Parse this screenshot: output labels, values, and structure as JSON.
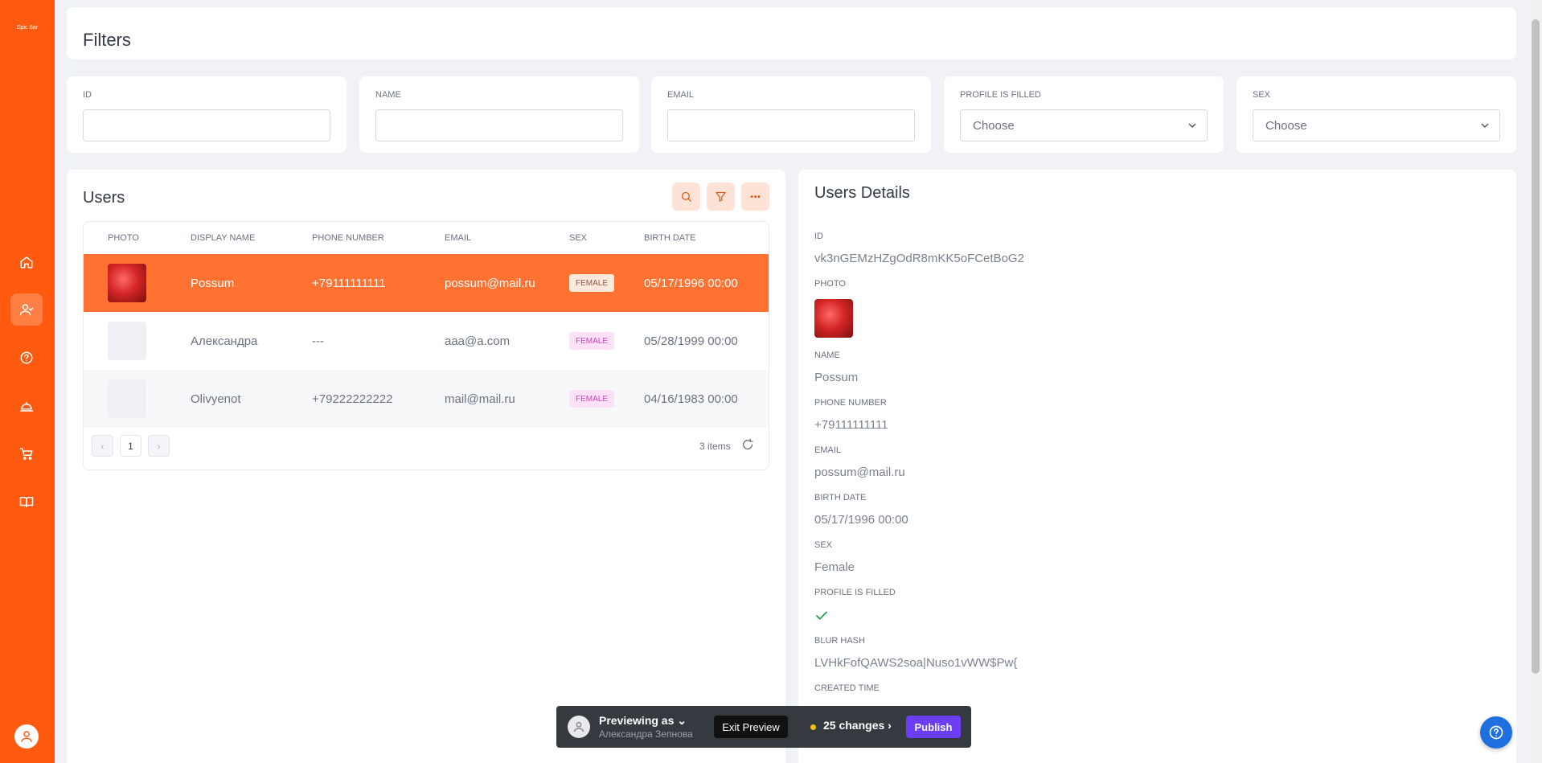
{
  "sidebar": {
    "brand": "Epic Bar",
    "items": [
      {
        "name": "home-icon"
      },
      {
        "name": "users-icon",
        "active": true
      },
      {
        "name": "help-circle-icon"
      },
      {
        "name": "dish-icon"
      },
      {
        "name": "cart-icon"
      },
      {
        "name": "book-icon"
      }
    ]
  },
  "filters": {
    "title": "Filters",
    "fields": [
      {
        "label": "ID",
        "value": ""
      },
      {
        "label": "NAME",
        "value": ""
      },
      {
        "label": "EMAIL",
        "value": ""
      },
      {
        "label": "PROFILE IS FILLED",
        "value": "Choose"
      },
      {
        "label": "SEX",
        "value": "Choose"
      }
    ]
  },
  "users": {
    "title": "Users",
    "columns": [
      "PHOTO",
      "DISPLAY NAME",
      "PHONE NUMBER",
      "EMAIL",
      "SEX",
      "BIRTH DATE"
    ],
    "rows": [
      {
        "name": "Possum",
        "phone": "+79111111111",
        "email": "possum@mail.ru",
        "sex": "FEMALE",
        "birth": "05/17/1996 00:00"
      },
      {
        "name": "Александра",
        "phone": "---",
        "email": "aaa@a.com",
        "sex": "FEMALE",
        "birth": "05/28/1999 00:00"
      },
      {
        "name": "Olivyenot",
        "phone": "+79222222222",
        "email": "mail@mail.ru",
        "sex": "FEMALE",
        "birth": "04/16/1983 00:00"
      }
    ],
    "pager": {
      "prev": "‹",
      "page": "1",
      "next": "›"
    },
    "count": "3 items"
  },
  "details": {
    "title": "Users Details",
    "fields": {
      "id_label": "ID",
      "id": "vk3nGEMzHZgOdR8mKK5oFCetBoG2",
      "photo_label": "PHOTO",
      "name_label": "NAME",
      "name": "Possum",
      "phone_label": "PHONE NUMBER",
      "phone": "+79111111111",
      "email_label": "EMAIL",
      "email": "possum@mail.ru",
      "birth_label": "BIRTH DATE",
      "birth": "05/17/1996 00:00",
      "sex_label": "SEX",
      "sex": "Female",
      "profile_label": "PROFILE IS FILLED",
      "blur_label": "BLUR HASH",
      "blur": "LVHkFofQAWS2soa|Nuso1vWW$Pw{",
      "created_label": "CREATED TIME"
    }
  },
  "preview": {
    "title": "Previewing as",
    "user": "Александра Зепнова",
    "exit": "Exit Preview",
    "changes": "25 changes",
    "publish": "Publish"
  },
  "colors": {
    "accent": "#ff5a10",
    "selected_row": "#ff7231",
    "publish": "#6b3ef5",
    "help": "#1f6fe0"
  }
}
